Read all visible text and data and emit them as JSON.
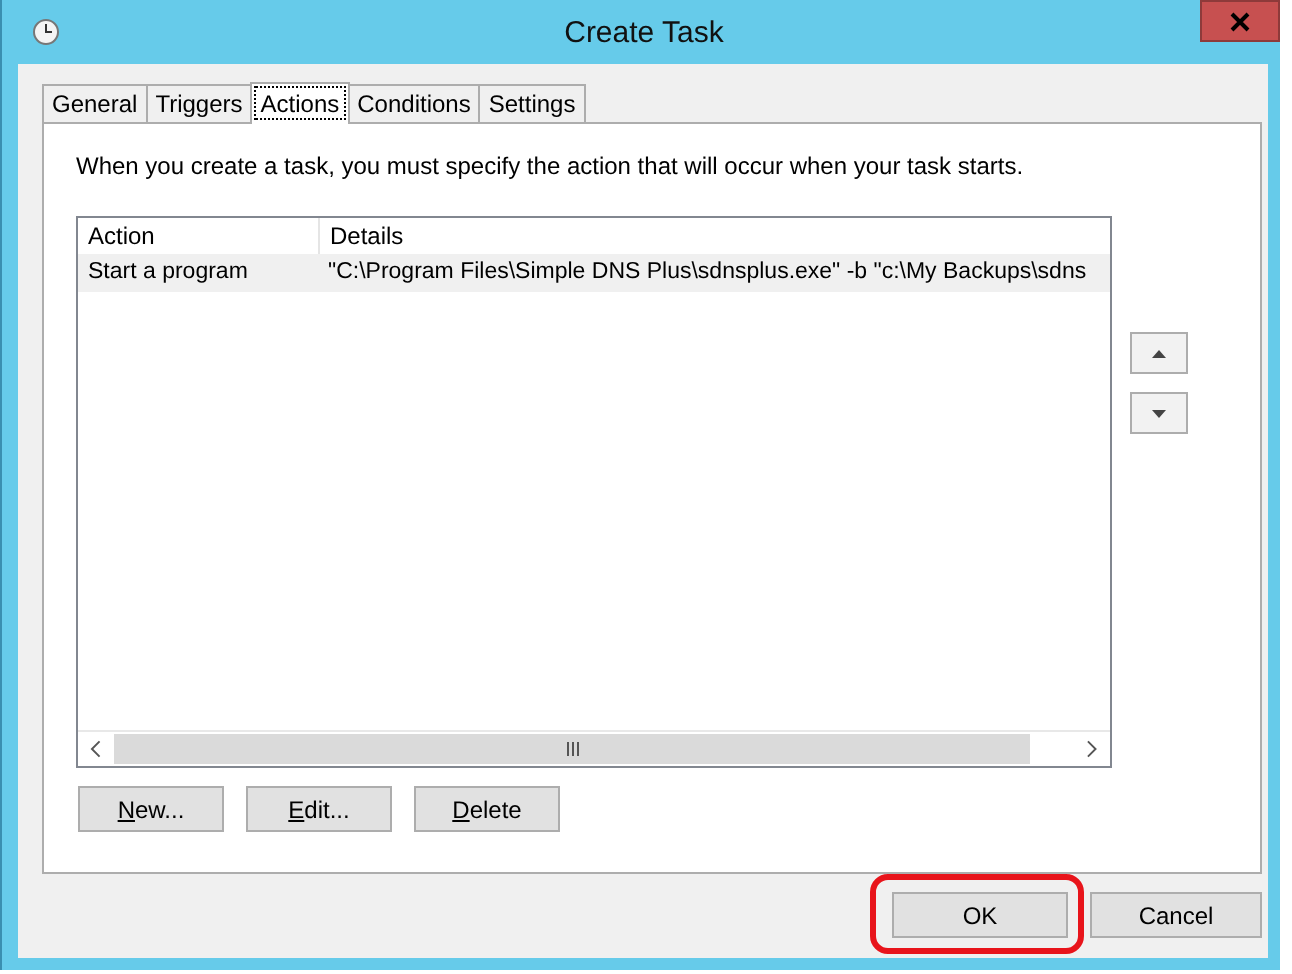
{
  "window": {
    "title": "Create Task"
  },
  "tabs": [
    {
      "label": "General",
      "selected": false
    },
    {
      "label": "Triggers",
      "selected": false
    },
    {
      "label": "Actions",
      "selected": true
    },
    {
      "label": "Conditions",
      "selected": false
    },
    {
      "label": "Settings",
      "selected": false
    }
  ],
  "description": "When you create a task, you must specify the action that will occur when your task starts.",
  "table": {
    "columns": [
      "Action",
      "Details"
    ],
    "rows": [
      {
        "cells": [
          "Start a program",
          "\"C:\\Program Files\\Simple DNS Plus\\sdnsplus.exe\" -b \"c:\\My Backups\\sdns"
        ],
        "selected": true
      }
    ]
  },
  "list_buttons": [
    {
      "label": "New...",
      "access_key_underlined": true
    },
    {
      "label": "Edit...",
      "access_key_underlined": true
    },
    {
      "label": "Delete",
      "access_key_underlined": true
    }
  ],
  "dialog_buttons": [
    {
      "label": "OK",
      "highlighted": true
    },
    {
      "label": "Cancel",
      "highlighted": false
    }
  ]
}
